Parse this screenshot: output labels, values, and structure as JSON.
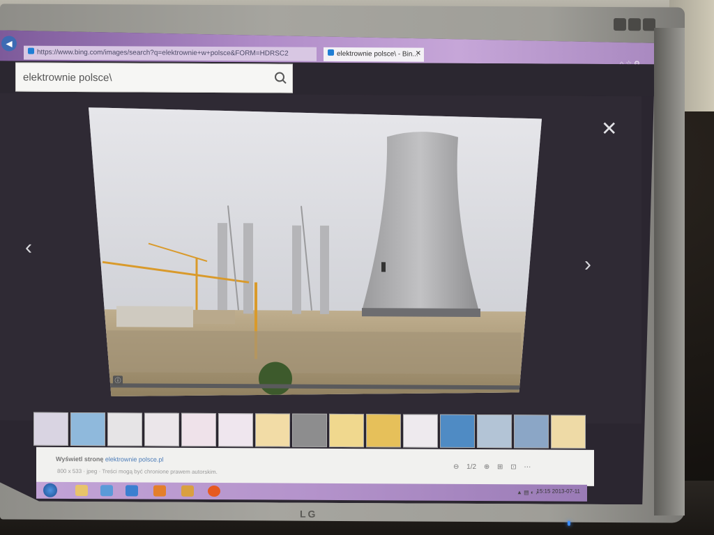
{
  "monitor": {
    "brand_top": "",
    "brand_bottom": "LG"
  },
  "browser": {
    "nav_back": "◀",
    "tabs": [
      {
        "label": "https://www.bing.com/images/search?q=elektrownie+w+polsce&FORM=HDRSC2",
        "type": "url"
      },
      {
        "label": "elektrownie polsce\\ - Bin...",
        "type": "active"
      }
    ],
    "window_controls": "⌂ ☆ ⚙"
  },
  "search": {
    "query": "elektrownie polsce\\",
    "icon": "search-icon"
  },
  "viewer": {
    "prev": "‹",
    "next": "›",
    "close": "✕",
    "photo": "cooling tower and chimneys under construction"
  },
  "thumbnails": [
    {
      "color": "#d9d4e2"
    },
    {
      "color": "#8fb9dc"
    },
    {
      "color": "#e6e4e6"
    },
    {
      "color": "#ebe6ea"
    },
    {
      "color": "#efe2ea"
    },
    {
      "color": "#efe6ee"
    },
    {
      "color": "#f2dca6"
    },
    {
      "color": "#8d8d8e"
    },
    {
      "color": "#f0d88e"
    },
    {
      "color": "#e6c05a"
    },
    {
      "color": "#eeeaee"
    },
    {
      "color": "#4f8bc4"
    },
    {
      "color": "#b3c4d6"
    },
    {
      "color": "#8ba6c6"
    },
    {
      "color": "#eedaa6"
    }
  ],
  "details": {
    "site_prefix": "Wyświetl stronę",
    "site_link": "elektrownie polsce.pl",
    "meta": "800 x 533 · jpeg · Treści mogą być chronione prawem autorskim.",
    "controls": [
      "⊖",
      "1/2",
      "⊕",
      "⊞",
      "⊡",
      "⋯"
    ]
  },
  "taskbar": {
    "clock": "15:15\n2013-07-11",
    "tray": "▲ ▤ ◐ ♪"
  }
}
